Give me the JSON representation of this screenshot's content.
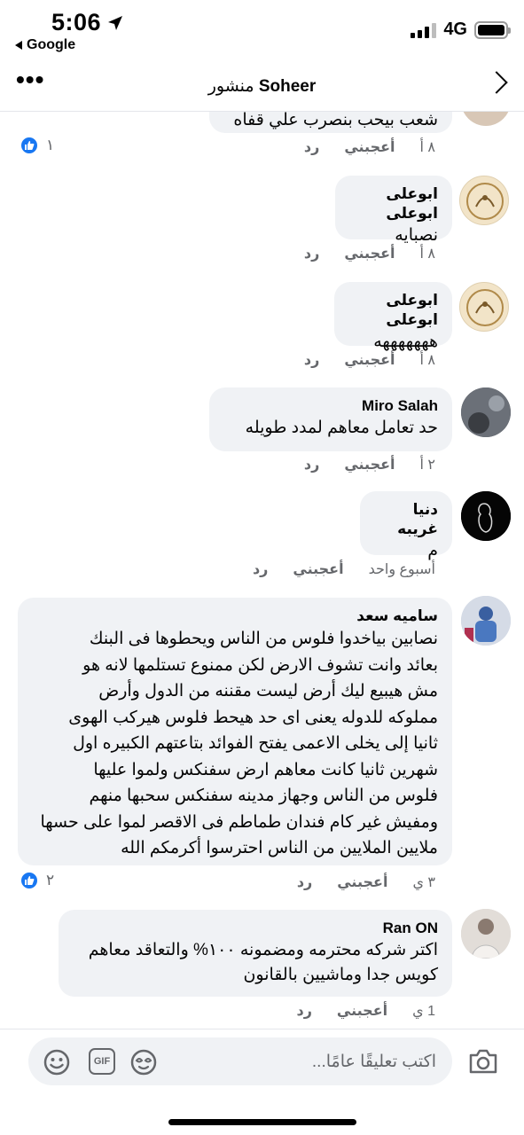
{
  "status": {
    "time": "5:06",
    "back_label": "Google",
    "network": "4G"
  },
  "header": {
    "title_prefix": "منشور",
    "title_name": "Soheer"
  },
  "comments": [
    {
      "partial_text": "شعب بيحب بنصرب علي قفاه",
      "meta": {
        "time": "٨ أ",
        "like": "أعجبني",
        "reply": "رد"
      },
      "reactions": "١"
    },
    {
      "name": "ابوعلى ابوعلى",
      "text": "نصبايه",
      "meta": {
        "time": "٨ أ",
        "like": "أعجبني",
        "reply": "رد"
      }
    },
    {
      "name": "ابوعلى ابوعلى",
      "text": "هههههههه",
      "meta": {
        "time": "٨ أ",
        "like": "أعجبني",
        "reply": "رد"
      }
    },
    {
      "name": "Miro Salah",
      "text": "حد تعامل معاهم لمدد طويله",
      "meta": {
        "time": "٢ أ",
        "like": "أعجبني",
        "reply": "رد"
      }
    },
    {
      "name": "دنيا غريبه",
      "text": "م",
      "meta": {
        "time": "أسبوع واحد",
        "like": "أعجبني",
        "reply": "رد"
      }
    },
    {
      "name": "ساميه سعد",
      "text_lines": [
        "نصابين بياخدوا فلوس من الناس ويحطوها فى البنك",
        "بعائد وانت تشوف الارض لكن ممنوع تستلمها لانه هو",
        "مش هيبيع ليك أرض ليست مقننه من الدول وأرض",
        "مملوكه للدوله يعنى اى حد هيحط فلوس هيركب الهوى",
        "ثانيا إلى يخلى الاعمى يفتح الفوائد بتاعتهم الكبيره اول",
        "شهرين ثانيا كانت معاهم ارض سفنكس ولموا عليها",
        "فلوس من الناس وجهاز مدينه سفنكس سحبها منهم",
        "ومفيش غير كام فندان طماطم فى الاقصر لموا على حسها",
        "ملايين الملايين من الناس احترسوا أكرمكم الله"
      ],
      "meta": {
        "time": "٣ ي",
        "like": "أعجبني",
        "reply": "رد"
      },
      "reactions": "٢"
    },
    {
      "name": "Ran ON",
      "text_lines": [
        "اكتر شركه محترمه ومضمونه ١٠٠% والتعاقد معاهم",
        "كويس جدا وماشيين بالقانون"
      ],
      "meta": {
        "time": "1 ي",
        "like": "أعجبني",
        "reply": "رد"
      }
    }
  ],
  "composer": {
    "placeholder": "اكتب تعليقًا عامًا..."
  },
  "colors": {
    "accent": "#1877f2",
    "bubble": "#f0f2f5",
    "muted": "#65676b"
  }
}
